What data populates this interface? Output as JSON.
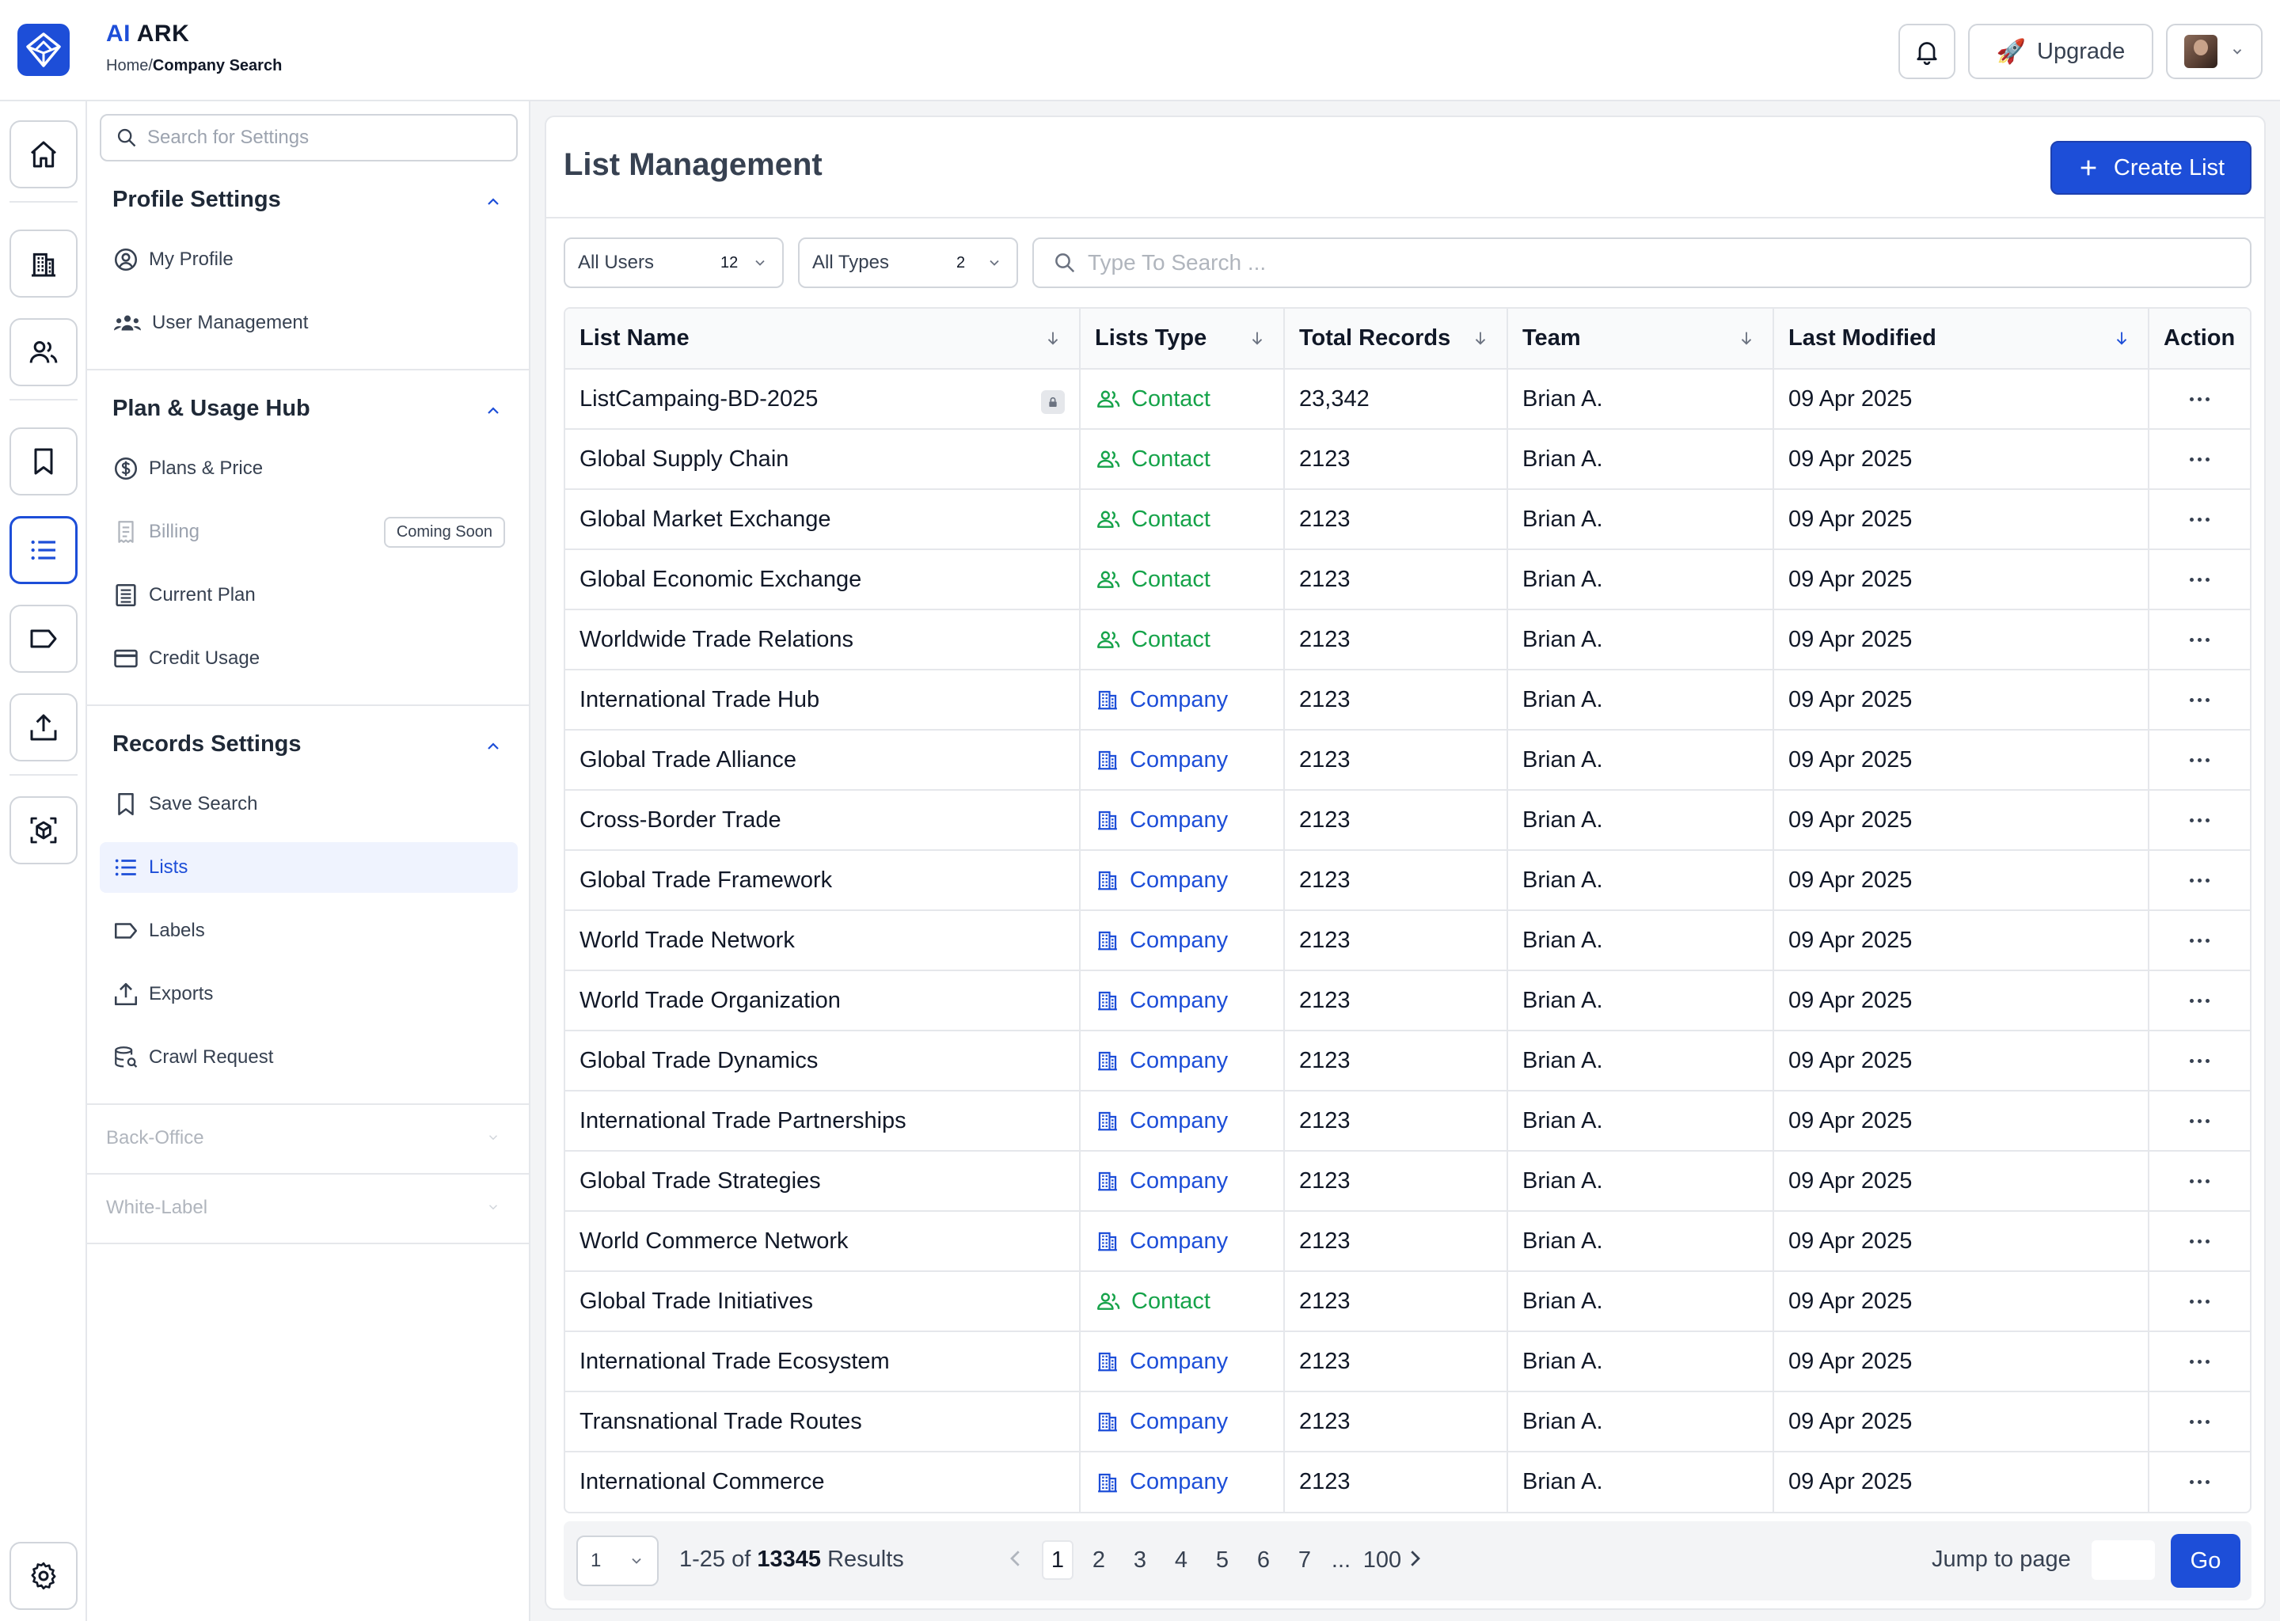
{
  "header": {
    "app_name_prefix": "AI",
    "app_name_suffix": "ARK",
    "breadcrumb_root": "Home/",
    "breadcrumb_current": "Company Search",
    "upgrade_label": "Upgrade",
    "upgrade_emoji": "🚀"
  },
  "rail": [
    "home-icon",
    "building-icon",
    "users-icon",
    "bookmark-icon",
    "list-icon",
    "label-icon",
    "upload-icon",
    "cube-scan-icon",
    "gear-icon"
  ],
  "settings": {
    "search_placeholder": "Search for Settings",
    "profile_title": "Profile Settings",
    "profile_items": [
      "My Profile",
      "User Management"
    ],
    "plan_title": "Plan & Usage Hub",
    "plan_items": [
      "Plans & Price",
      "Billing",
      "Current Plan",
      "Credit Usage"
    ],
    "billing_badge": "Coming Soon",
    "records_title": "Records Settings",
    "records_items": [
      "Save Search",
      "Lists",
      "Labels",
      "Exports",
      "Crawl Request"
    ],
    "back_office": "Back-Office",
    "white_label": "White-Label"
  },
  "main": {
    "title": "List Management",
    "create_label": "Create List",
    "filter_users": "All Users",
    "filter_users_count": "12",
    "filter_types": "All Types",
    "filter_types_count": "2",
    "search_placeholder": "Type To Search ...",
    "columns": [
      "List Name",
      "Lists Type",
      "Total Records",
      "Team",
      "Last Modified",
      "Action"
    ],
    "rows": [
      {
        "name": "ListCampaing-BD-2025",
        "type": "Contact",
        "records": "23,342",
        "team": "Brian A.",
        "modified": "09 Apr 2025",
        "locked": true
      },
      {
        "name": "Global Supply Chain",
        "type": "Contact",
        "records": "2123",
        "team": "Brian A.",
        "modified": "09 Apr 2025"
      },
      {
        "name": "Global Market Exchange",
        "type": "Contact",
        "records": "2123",
        "team": "Brian A.",
        "modified": "09 Apr 2025"
      },
      {
        "name": "Global Economic Exchange",
        "type": "Contact",
        "records": "2123",
        "team": "Brian A.",
        "modified": "09 Apr 2025"
      },
      {
        "name": "Worldwide Trade Relations",
        "type": "Contact",
        "records": "2123",
        "team": "Brian A.",
        "modified": "09 Apr 2025"
      },
      {
        "name": "International Trade Hub",
        "type": "Company",
        "records": "2123",
        "team": "Brian A.",
        "modified": "09 Apr 2025"
      },
      {
        "name": "Global Trade Alliance",
        "type": "Company",
        "records": "2123",
        "team": "Brian A.",
        "modified": "09 Apr 2025"
      },
      {
        "name": "Cross-Border Trade",
        "type": "Company",
        "records": "2123",
        "team": "Brian A.",
        "modified": "09 Apr 2025"
      },
      {
        "name": "Global Trade Framework",
        "type": "Company",
        "records": "2123",
        "team": "Brian A.",
        "modified": "09 Apr 2025"
      },
      {
        "name": "World Trade Network",
        "type": "Company",
        "records": "2123",
        "team": "Brian A.",
        "modified": "09 Apr 2025"
      },
      {
        "name": "World Trade Organization",
        "type": "Company",
        "records": "2123",
        "team": "Brian A.",
        "modified": "09 Apr 2025"
      },
      {
        "name": "Global Trade Dynamics",
        "type": "Company",
        "records": "2123",
        "team": "Brian A.",
        "modified": "09 Apr 2025"
      },
      {
        "name": "International Trade Partnerships",
        "type": "Company",
        "records": "2123",
        "team": "Brian A.",
        "modified": "09 Apr 2025"
      },
      {
        "name": "Global Trade Strategies",
        "type": "Company",
        "records": "2123",
        "team": "Brian A.",
        "modified": "09 Apr 2025"
      },
      {
        "name": "World Commerce Network",
        "type": "Company",
        "records": "2123",
        "team": "Brian A.",
        "modified": "09 Apr 2025"
      },
      {
        "name": "Global Trade Initiatives",
        "type": "Contact",
        "records": "2123",
        "team": "Brian A.",
        "modified": "09 Apr 2025"
      },
      {
        "name": "International Trade Ecosystem",
        "type": "Company",
        "records": "2123",
        "team": "Brian A.",
        "modified": "09 Apr 2025"
      },
      {
        "name": "Transnational Trade Routes",
        "type": "Company",
        "records": "2123",
        "team": "Brian A.",
        "modified": "09 Apr 2025"
      },
      {
        "name": "International Commerce",
        "type": "Company",
        "records": "2123",
        "team": "Brian A.",
        "modified": "09 Apr 2025"
      }
    ]
  },
  "pagination": {
    "per_page": "1",
    "range": "1-25 of",
    "total": "13345",
    "results_label": "Results",
    "pages": [
      "1",
      "2",
      "3",
      "4",
      "5",
      "6",
      "7",
      "...",
      "100"
    ],
    "current": "1",
    "jump_label": "Jump to page",
    "go_label": "Go"
  },
  "colors": {
    "accent": "#1d4ed8",
    "contact": "#16a34a",
    "company": "#1d4ed8"
  }
}
